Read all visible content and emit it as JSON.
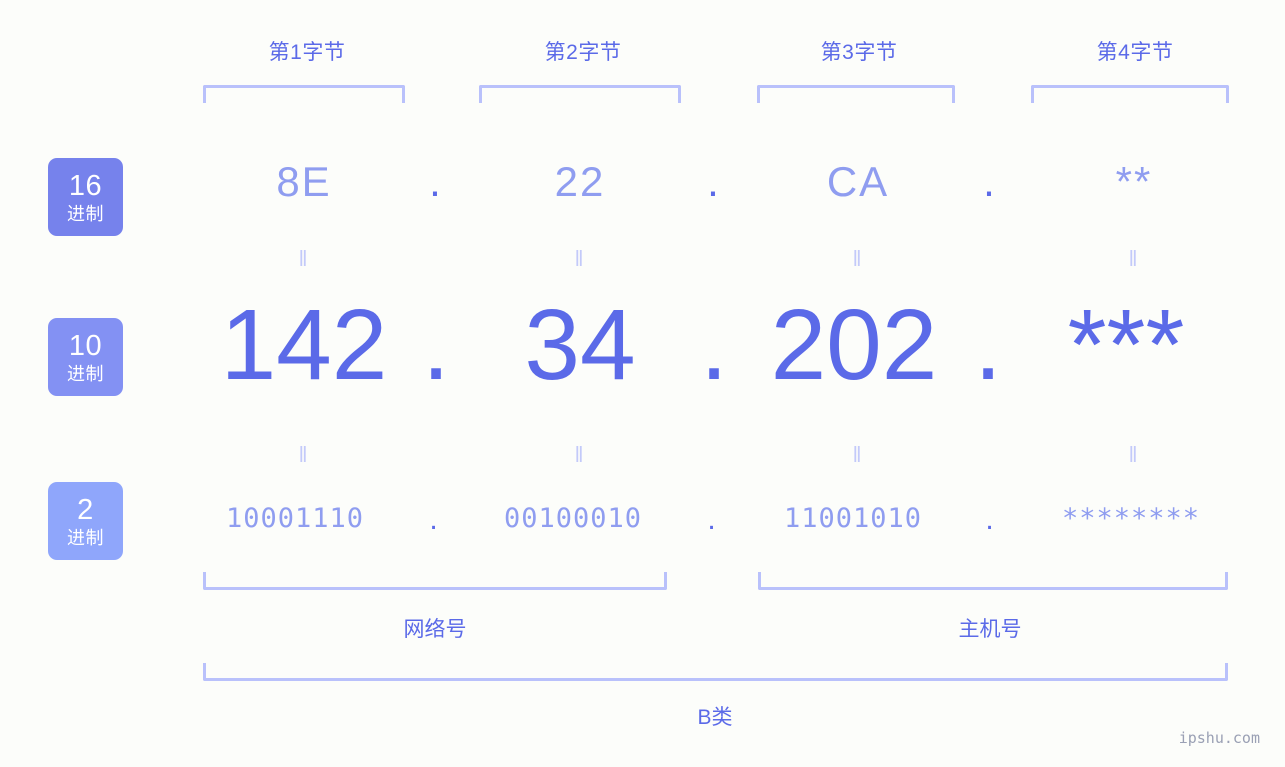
{
  "background_color": "#fcfdfa",
  "accent_color": "#5b6ae8",
  "accent_light_color": "#8f9df0",
  "bracket_color": "#b9c1fb",
  "byte_headers": [
    {
      "label": "第1字节"
    },
    {
      "label": "第2字节"
    },
    {
      "label": "第3字节"
    },
    {
      "label": "第4字节"
    }
  ],
  "bases": [
    {
      "num": "16",
      "suffix": "进制",
      "color": "#7682ec"
    },
    {
      "num": "10",
      "suffix": "进制",
      "color": "#8391f3"
    },
    {
      "num": "2",
      "suffix": "进制",
      "color": "#8fa6fb"
    }
  ],
  "separator": ".",
  "equals_mark": "‖",
  "rows": {
    "hex": {
      "base": "16",
      "octets": [
        "8E",
        "22",
        "CA",
        "**"
      ]
    },
    "decimal": {
      "base": "10",
      "octets": [
        "142",
        "34",
        "202",
        "***"
      ]
    },
    "binary": {
      "base": "2",
      "octets": [
        "10001110",
        "00100010",
        "11001010",
        "********"
      ]
    }
  },
  "sections": [
    {
      "label": "网络号"
    },
    {
      "label": "主机号"
    }
  ],
  "class_label": "B类",
  "watermark": "ipshu.com"
}
